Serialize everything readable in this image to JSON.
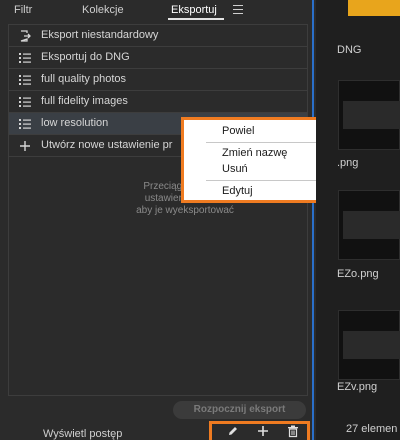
{
  "tabs": [
    "Filtr",
    "Kolekcje",
    "Eksportuj"
  ],
  "presets": [
    {
      "label": "Eksport niestandardowy",
      "icon": "export-icon"
    },
    {
      "label": "Eksportuj do DNG",
      "icon": "list-icon"
    },
    {
      "label": "full quality photos",
      "icon": "list-icon"
    },
    {
      "label": "full fidelity images",
      "icon": "list-icon"
    },
    {
      "label": "low resolution",
      "icon": "list-icon",
      "selected": true
    },
    {
      "label": "Utwórz nowe ustawienie pr",
      "icon": "plus-icon"
    }
  ],
  "hint": {
    "line1": "Przeciągnij i upuść",
    "line2": "ustawienie predefi",
    "line3": "aby je wyeksportować"
  },
  "context_menu": {
    "items": [
      "Powiel",
      "Zmień nazwę",
      "Usuń",
      "Edytuj"
    ]
  },
  "export_button": "Rozpocznij eksport",
  "progress_link": "Wyświetl postęp",
  "toolbar": {
    "icons": [
      "pencil-icon",
      "plus-icon",
      "trash-icon"
    ]
  },
  "files": [
    "DNG",
    ".png",
    "EZo.png",
    "EZv.png"
  ],
  "file_count": "27 elemen",
  "colors": {
    "accent": "#ef7b21",
    "selection": "#3a3f45",
    "panel": "#2b2b2b"
  }
}
